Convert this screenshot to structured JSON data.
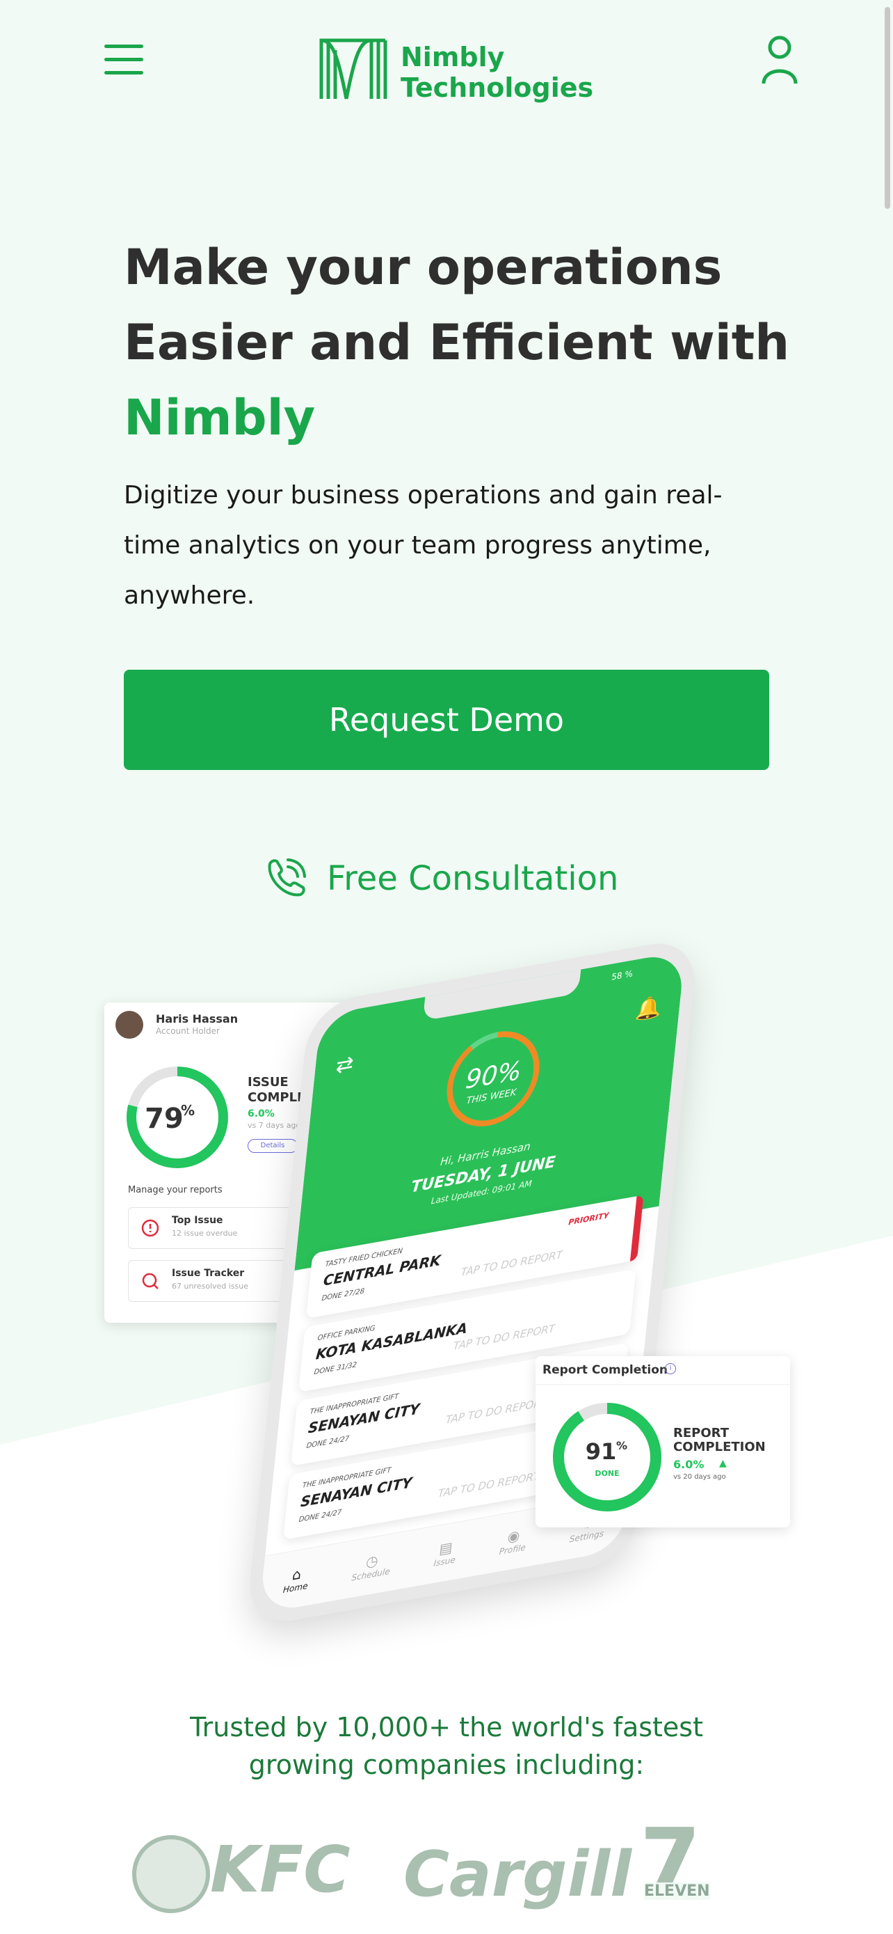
{
  "header": {
    "logo_line1": "Nimbly",
    "logo_line2": "Technologies",
    "menu_icon": "hamburger-icon",
    "user_icon": "user-icon"
  },
  "hero": {
    "title_line1": "Make your operations",
    "title_line2": "Easier and Efficient with",
    "title_accent": "Nimbly",
    "subtitle": "Digitize your business operations and gain real-time analytics on your team progress anytime, anywhere.",
    "demo_button": "Request Demo",
    "consultation_label": "Free Consultation",
    "consultation_icon": "phone-icon"
  },
  "left_card": {
    "name": "Haris Hassan",
    "role": "Account Holder",
    "percent": "79",
    "percent_sign": "%",
    "progress_value": 0.79,
    "title_line1": "ISSUE",
    "title_line2": "COMPLETION",
    "change": "6.0%",
    "compare": "vs 7 days ago",
    "details": "Details",
    "manage": "Manage your reports",
    "items": [
      {
        "title": "Top Issue",
        "sub": "12 issue overdue"
      },
      {
        "title": "Issue Tracker",
        "sub": "67 unresolved issue"
      }
    ]
  },
  "phone": {
    "percent": "90%",
    "week": "THIS WEEK",
    "progress_value": 0.9,
    "greeting": "Hi, Harris Hassan",
    "date": "TUESDAY, 1 JUNE",
    "updated": "Last Updated: 09:01 AM",
    "battery": "58 %",
    "reports": [
      {
        "category": "TASTY FRIED CHICKEN",
        "name": "CENTRAL PARK",
        "done": "DONE 27/28",
        "action": "TAP TO DO REPORT",
        "badge": "PRIORITY"
      },
      {
        "category": "OFFICE PARKING",
        "name": "KOTA KASABLANKA",
        "done": "DONE 31/32",
        "action": "TAP TO DO REPORT",
        "badge": ""
      },
      {
        "category": "THE INAPPROPRIATE GIFT",
        "name": "SENAYAN CITY",
        "done": "DONE 24/27",
        "action": "TAP TO DO REPORT",
        "badge": ""
      },
      {
        "category": "THE INAPPROPRIATE GIFT",
        "name": "SENAYAN CITY",
        "done": "DONE 24/27",
        "action": "TAP TO DO REPORT",
        "badge": ""
      }
    ],
    "nav": [
      "Home",
      "Schedule",
      "Issue",
      "Profile",
      "Settings"
    ]
  },
  "right_card": {
    "title": "Report Completion",
    "percent": "91",
    "percent_sign": "%",
    "done": "DONE",
    "progress_value": 0.91,
    "label_line1": "REPORT",
    "label_line2": "COMPLETION",
    "change": "6.0%",
    "compare": "vs 20 days ago"
  },
  "trusted": {
    "text_line1": "Trusted by 10,000+ the world's fastest",
    "text_line2": "growing companies including:"
  },
  "brands": [
    "KFC",
    "Cargill",
    "ELEVEN"
  ],
  "colors": {
    "accent": "#1aa64b",
    "button": "#17ab4e",
    "background": "#f1faf5",
    "priority": "#e02b3c"
  }
}
